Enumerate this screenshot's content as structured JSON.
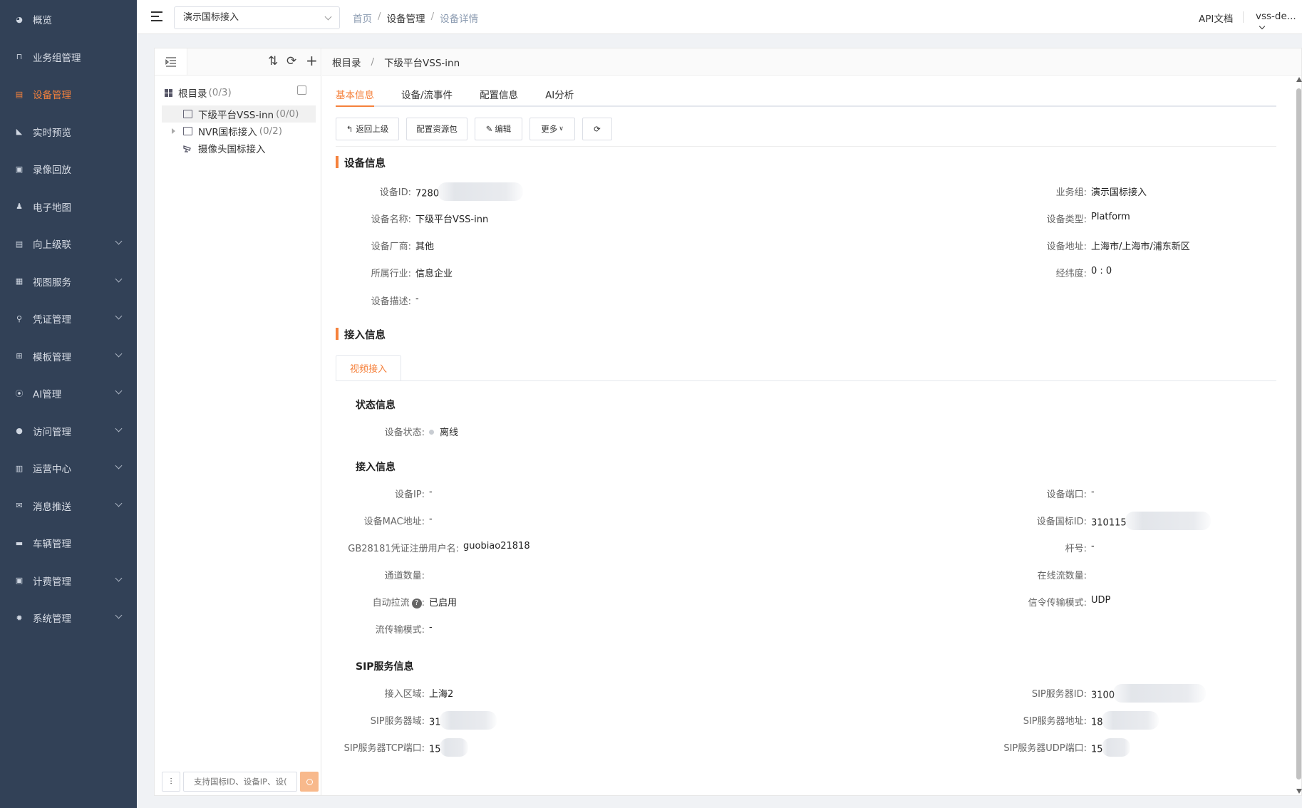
{
  "sidebar": {
    "items": [
      {
        "label": "概览",
        "icon": "dashboard-icon",
        "active": false,
        "expand": false
      },
      {
        "label": "业务组管理",
        "icon": "group-icon",
        "active": false,
        "expand": false
      },
      {
        "label": "设备管理",
        "icon": "device-icon",
        "active": true,
        "expand": false
      },
      {
        "label": "实时预览",
        "icon": "camera-icon",
        "active": false,
        "expand": false
      },
      {
        "label": "录像回放",
        "icon": "playback-icon",
        "active": false,
        "expand": false
      },
      {
        "label": "电子地图",
        "icon": "map-icon",
        "active": false,
        "expand": false
      },
      {
        "label": "向上级联",
        "icon": "cascade-icon",
        "active": false,
        "expand": true
      },
      {
        "label": "视图服务",
        "icon": "view-icon",
        "active": false,
        "expand": true
      },
      {
        "label": "凭证管理",
        "icon": "key-icon",
        "active": false,
        "expand": true
      },
      {
        "label": "模板管理",
        "icon": "template-icon",
        "active": false,
        "expand": true
      },
      {
        "label": "AI管理",
        "icon": "ai-icon",
        "active": false,
        "expand": true
      },
      {
        "label": "访问管理",
        "icon": "user-icon",
        "active": false,
        "expand": true
      },
      {
        "label": "运营中心",
        "icon": "building-icon",
        "active": false,
        "expand": true
      },
      {
        "label": "消息推送",
        "icon": "message-icon",
        "active": false,
        "expand": true
      },
      {
        "label": "车辆管理",
        "icon": "car-icon",
        "active": false,
        "expand": false
      },
      {
        "label": "计费管理",
        "icon": "billing-icon",
        "active": false,
        "expand": true
      },
      {
        "label": "系统管理",
        "icon": "gear-icon",
        "active": false,
        "expand": true
      }
    ]
  },
  "topbar": {
    "group_select": "演示国标接入",
    "breadcrumb": [
      "首页",
      "设备管理",
      "设备详情"
    ],
    "api_doc": "API文档",
    "user": "vss-de..."
  },
  "tree": {
    "root_label": "根目录",
    "root_count": "(0/3)",
    "nodes": [
      {
        "label": "下级平台VSS-inn",
        "count": "(0/0)"
      },
      {
        "label": "NVR国标接入",
        "count": "(0/2)"
      },
      {
        "label": "摄像头国标接入",
        "count": ""
      }
    ],
    "search_placeholder": "支持国标ID、设备IP、设("
  },
  "main": {
    "breadcrumb": [
      "根目录",
      "/",
      "下级平台VSS-inn"
    ],
    "tabs": [
      "基本信息",
      "设备/流事件",
      "配置信息",
      "AI分析"
    ],
    "buttons": {
      "back": "返回上级",
      "config": "配置资源包",
      "edit": "编辑",
      "more": "更多"
    },
    "device_info": {
      "title": "设备信息",
      "id_label": "设备ID:",
      "id_value": "7280",
      "group_label": "业务组:",
      "group_value": "演示国标接入",
      "name_label": "设备名称:",
      "name_value": "下级平台VSS-inn",
      "type_label": "设备类型:",
      "type_value": "Platform",
      "vendor_label": "设备厂商:",
      "vendor_value": "其他",
      "addr_label": "设备地址:",
      "addr_value": "上海市/上海市/浦东新区",
      "industry_label": "所属行业:",
      "industry_value": "信息企业",
      "geo_label": "经纬度:",
      "geo_value": "0 : 0",
      "desc_label": "设备描述:",
      "desc_value": "-"
    },
    "access": {
      "title": "接入信息",
      "subtab": "视频接入",
      "status_title": "状态信息",
      "status_label": "设备状态:",
      "status_value": "离线",
      "access_title": "接入信息",
      "ip_label": "设备IP:",
      "ip_value": "-",
      "port_label": "设备端口:",
      "port_value": "-",
      "mac_label": "设备MAC地址:",
      "mac_value": "-",
      "gbid_label": "设备国标ID:",
      "gbid_value": "310115",
      "user_label": "GB28181凭证注册用户名:",
      "user_value": "guobiao21818",
      "pole_label": "杆号:",
      "pole_value": "-",
      "channels_label": "通道数量:",
      "channels_value": "",
      "online_label": "在线流数量:",
      "online_value": "",
      "autopull_label": "自动拉流",
      "autopull_value": "已启用",
      "signal_label": "信令传输模式:",
      "signal_value": "UDP",
      "stream_label": "流传输模式:",
      "stream_value": "-",
      "sip_title": "SIP服务信息",
      "region_label": "接入区域:",
      "region_value": "上海2",
      "sipid_label": "SIP服务器ID:",
      "sipid_value": "3100",
      "sipdomain_label": "SIP服务器域:",
      "sipdomain_value": "31",
      "sipaddr_label": "SIP服务器地址:",
      "sipaddr_value": "18",
      "siptcp_label": "SIP服务器TCP端口:",
      "siptcp_value": "15",
      "sipudp_label": "SIP服务器UDP端口:",
      "sipudp_value": "15"
    }
  }
}
